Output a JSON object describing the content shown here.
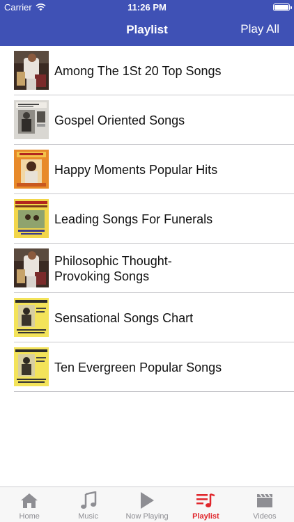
{
  "status_bar": {
    "carrier": "Carrier",
    "time": "11:26 PM",
    "battery_level": 1.0
  },
  "nav": {
    "title": "Playlist",
    "play_all_label": "Play All"
  },
  "playlists": [
    {
      "title": "Among The 1St 20 Top Songs",
      "thumb_icon": "album-cover-photo"
    },
    {
      "title": "Gospel Oriented Songs",
      "thumb_icon": "album-cover-bw"
    },
    {
      "title": "Happy Moments Popular Hits",
      "thumb_icon": "album-cover-orange"
    },
    {
      "title": "Leading Songs For Funerals",
      "thumb_icon": "album-cover-yellow"
    },
    {
      "title": "Philosophic Thought-\nProvoking Songs",
      "thumb_icon": "album-cover-photo"
    },
    {
      "title": "Sensational Songs Chart",
      "thumb_icon": "album-cover-oman"
    },
    {
      "title": "Ten Evergreen Popular Songs",
      "thumb_icon": "album-cover-oman"
    }
  ],
  "tabs": [
    {
      "label": "Home",
      "icon": "home-icon",
      "active": false
    },
    {
      "label": "Music",
      "icon": "music-note-icon",
      "active": false
    },
    {
      "label": "Now Playing",
      "icon": "play-icon",
      "active": false
    },
    {
      "label": "Playlist",
      "icon": "playlist-icon",
      "active": true
    },
    {
      "label": "Videos",
      "icon": "clapperboard-icon",
      "active": false
    }
  ],
  "colors": {
    "header": "#3f51b5",
    "active_tab": "#e0262c",
    "inactive_tab": "#8e8e93"
  }
}
